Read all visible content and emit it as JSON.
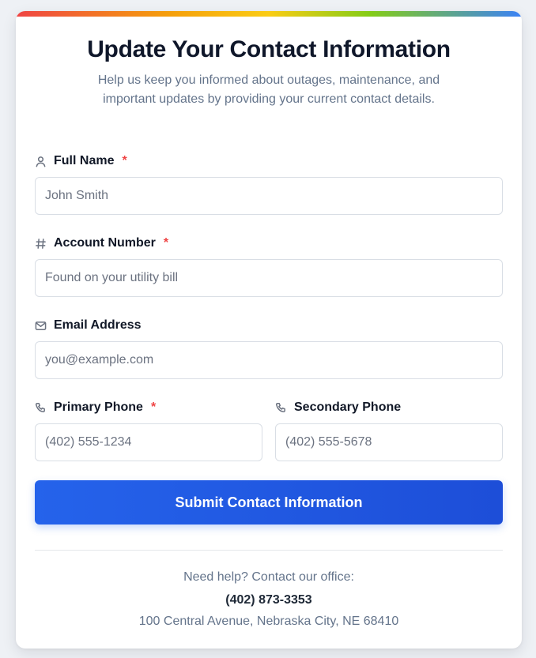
{
  "header": {
    "title": "Update Your Contact Information",
    "subtitle": "Help us keep you informed about outages, maintenance, and important updates by providing your current contact details."
  },
  "form": {
    "full_name": {
      "label": "Full Name",
      "required_mark": "*",
      "placeholder": "John Smith",
      "icon": "user-icon"
    },
    "account_number": {
      "label": "Account Number",
      "required_mark": "*",
      "placeholder": "Found on your utility bill",
      "icon": "hash-icon"
    },
    "email": {
      "label": "Email Address",
      "placeholder": "you@example.com",
      "icon": "mail-icon"
    },
    "primary_phone": {
      "label": "Primary Phone",
      "required_mark": "*",
      "placeholder": "(402) 555-1234",
      "icon": "phone-icon"
    },
    "secondary_phone": {
      "label": "Secondary Phone",
      "placeholder": "(402) 555-5678",
      "icon": "phone-icon"
    },
    "submit_label": "Submit Contact Information"
  },
  "footer": {
    "help_text": "Need help? Contact our office:",
    "phone": "(402) 873-3353",
    "address": "100 Central Avenue, Nebraska City, NE 68410"
  },
  "colors": {
    "primary": "#2563eb",
    "required": "#ef4444",
    "title": "#0f172a",
    "muted": "#64748b"
  }
}
